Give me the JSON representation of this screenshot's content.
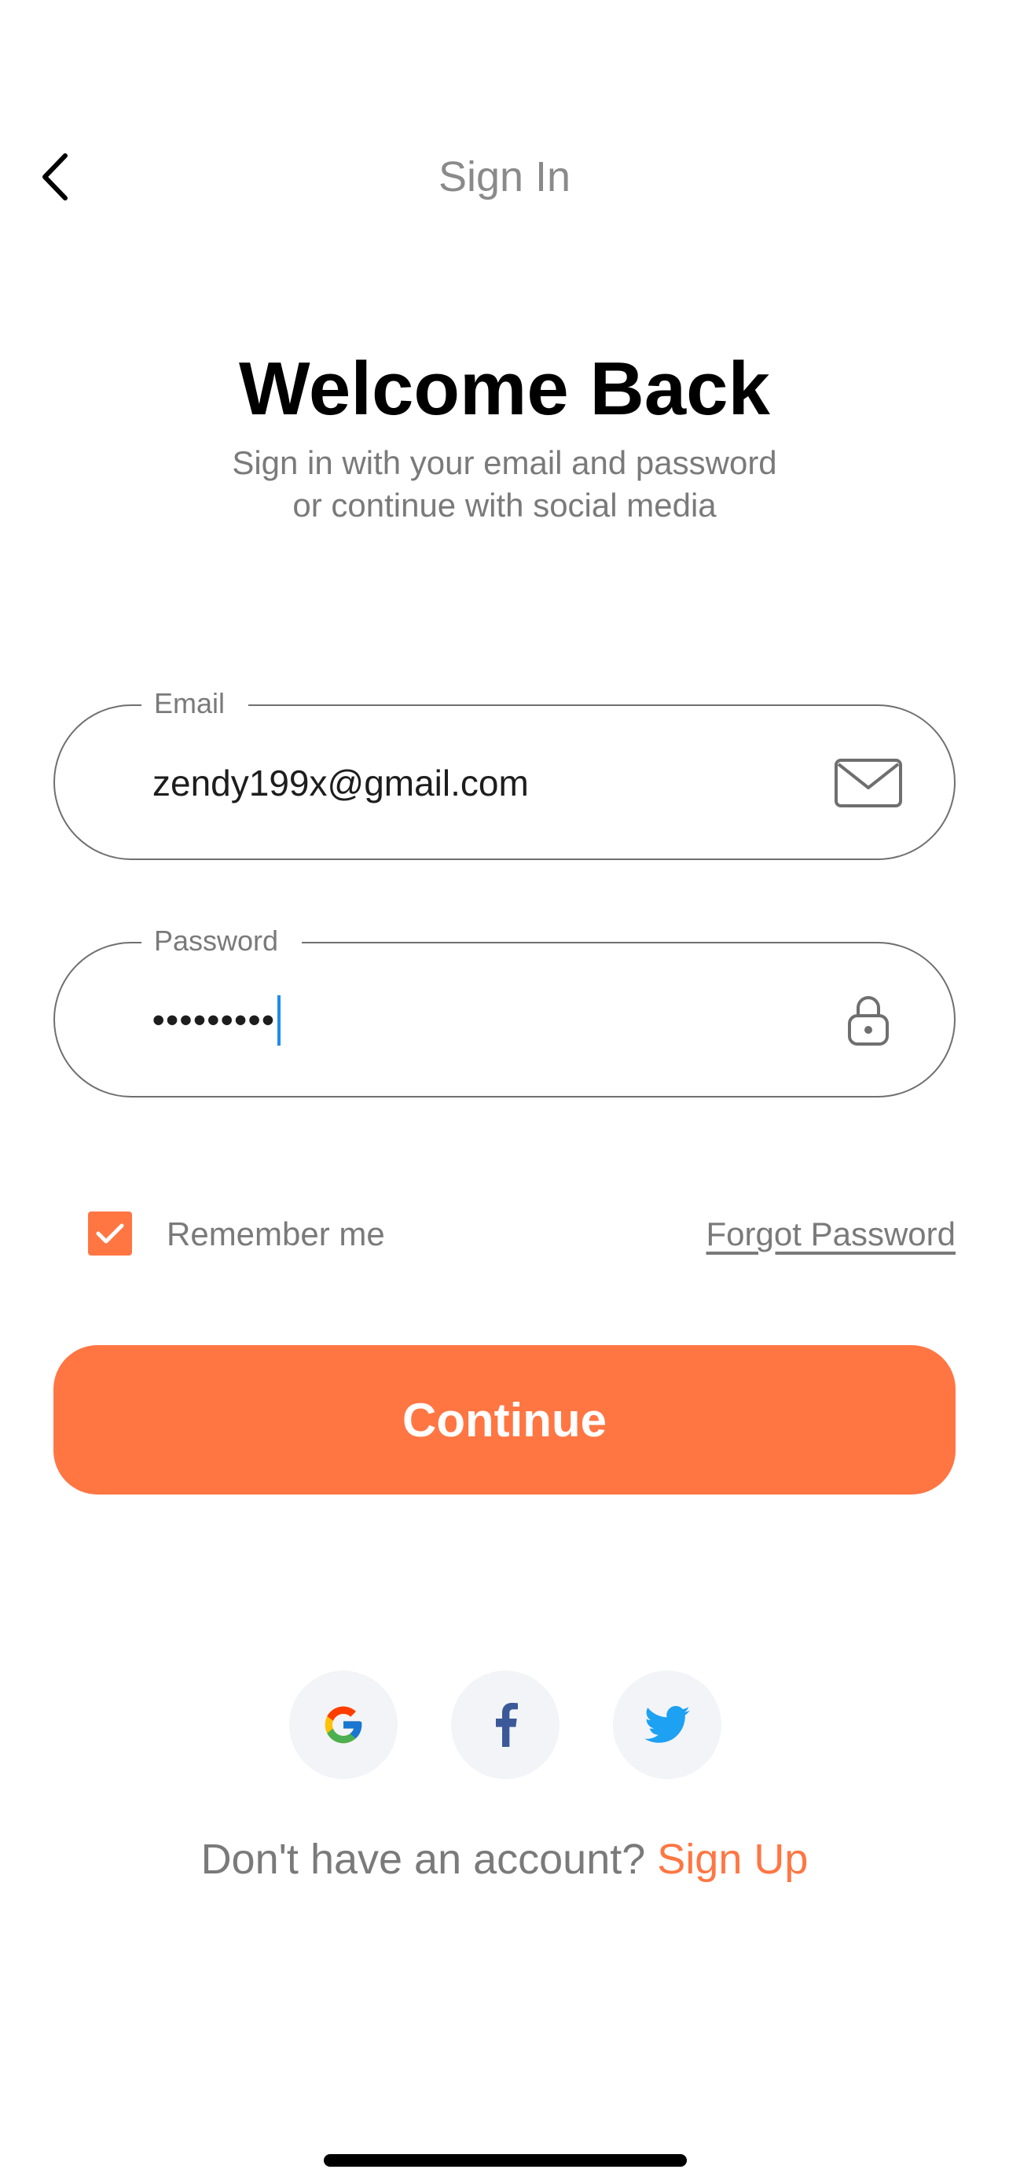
{
  "header": {
    "title": "Sign In",
    "back_icon": "chevron-left-icon"
  },
  "welcome": {
    "title": "Welcome Back",
    "subtitle_line1": "Sign in with your email and password",
    "subtitle_line2": "or continue with social media"
  },
  "email_field": {
    "label": "Email",
    "value": "zendy199x@gmail.com",
    "icon": "mail-icon"
  },
  "password_field": {
    "label": "Password",
    "value_masked": "•••••••••",
    "icon": "lock-icon"
  },
  "remember": {
    "label": "Remember me",
    "checked": true
  },
  "forgot_password": "Forgot Password",
  "continue_button": "Continue",
  "social": [
    "google-icon",
    "facebook-icon",
    "twitter-icon"
  ],
  "signup": {
    "prompt": "Don't have an account?",
    "link": "Sign Up"
  },
  "colors": {
    "accent": "#ff7643",
    "text_secondary": "#7a7a7a",
    "social_bg": "#f2f4f7",
    "caret": "#1d8bf1"
  }
}
